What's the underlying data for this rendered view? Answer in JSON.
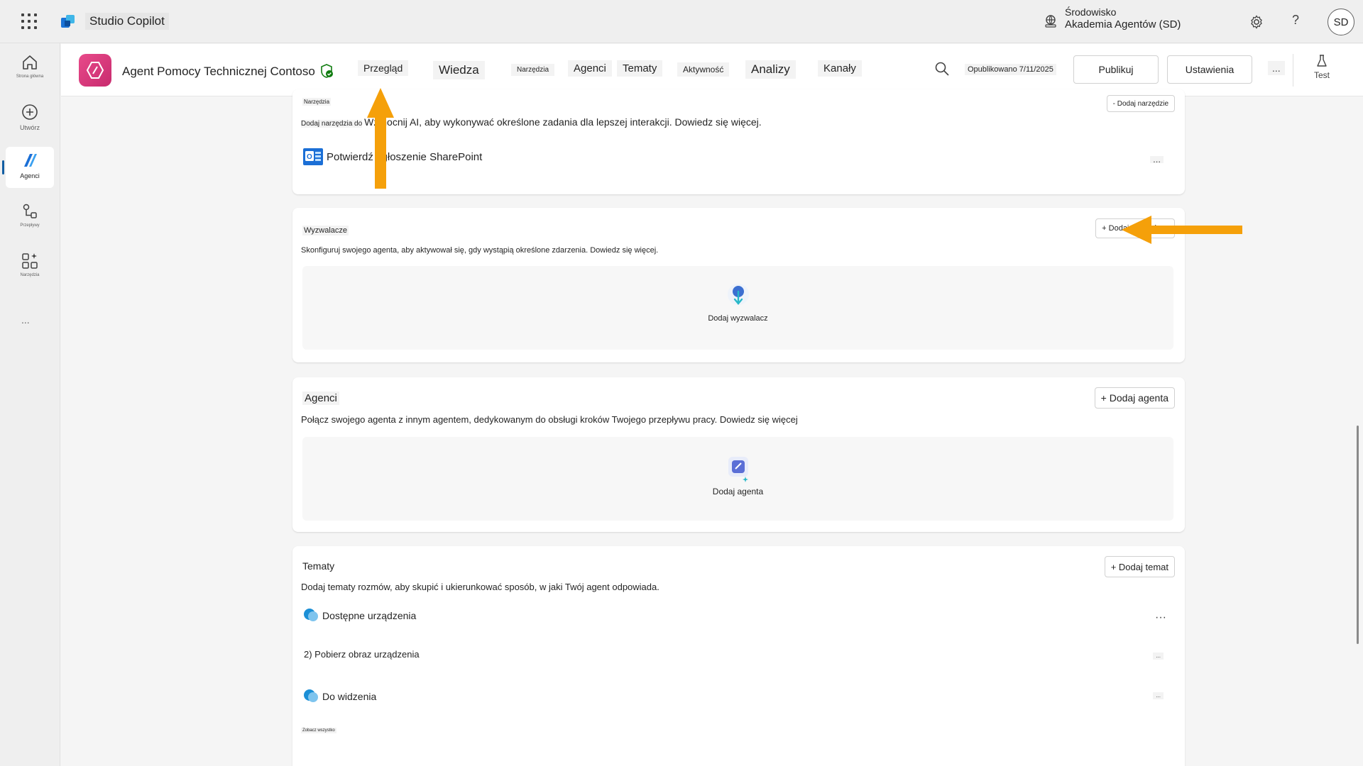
{
  "topbar": {
    "app_name": "Studio Copilot",
    "env_line1": "Środowisko",
    "env_line2": "Akademia Agentów (SD)",
    "help": "?",
    "avatar": "SD"
  },
  "rail": {
    "home": "Strona główna",
    "create": "Utwórz",
    "agents": "Agenci",
    "flows": "Przepływy",
    "tools": "Narzędzia",
    "more": "..."
  },
  "agent": {
    "name": "Agent Pomocy Technicznej Contoso",
    "tabs": [
      "Przegląd",
      "Wiedza",
      "Narzędzia",
      "Agenci",
      "Tematy",
      "Aktywność",
      "Analizy",
      "Kanały"
    ],
    "published": "Opublikowano 7/11/2025",
    "publish": "Publikuj",
    "settings": "Ustawienia",
    "more": "...",
    "test": "Test"
  },
  "tools_card": {
    "title": "Narzędzia",
    "add": "- Dodaj narzędzie",
    "desc_prefix": "Dodaj narzędzia do",
    "desc_main": "Wzmocnij AI, aby wykonywać określone zadania dla lepszej interakcji. Dowiedz się więcej.",
    "item": "Potwierdź zgłoszenie SharePoint",
    "item_more": "..."
  },
  "triggers_card": {
    "title": "Wyzwalacze",
    "add": "+ Dodaj wyzwalacz",
    "desc": "Skonfiguruj swojego agenta, aby aktywował się, gdy wystąpią określone zdarzenia. Dowiedz się więcej.",
    "empty_label": "Dodaj wyzwalacz"
  },
  "agents_card": {
    "title": "Agenci",
    "add": "+ Dodaj agenta",
    "desc": "Połącz swojego agenta z innym agentem, dedykowanym do obsługi kroków Twojego przepływu pracy. Dowiedz się więcej",
    "empty_label": "Dodaj agenta"
  },
  "topics_card": {
    "title": "Tematy",
    "add": "+ Dodaj temat",
    "desc": "Dodaj tematy rozmów, aby skupić i ukierunkować sposób, w jaki Twój agent odpowiada.",
    "topics": [
      "Dostępne urządzenia",
      "2) Pobierz obraz urządzenia",
      "Do widzenia"
    ],
    "row_more": [
      "···",
      "...",
      "..."
    ],
    "see_all": "Zobacz wszystko"
  },
  "colors": {
    "accent": "#0f6cbd",
    "arrow": "#f5a00a",
    "agent_icon": "#d63a7c"
  }
}
